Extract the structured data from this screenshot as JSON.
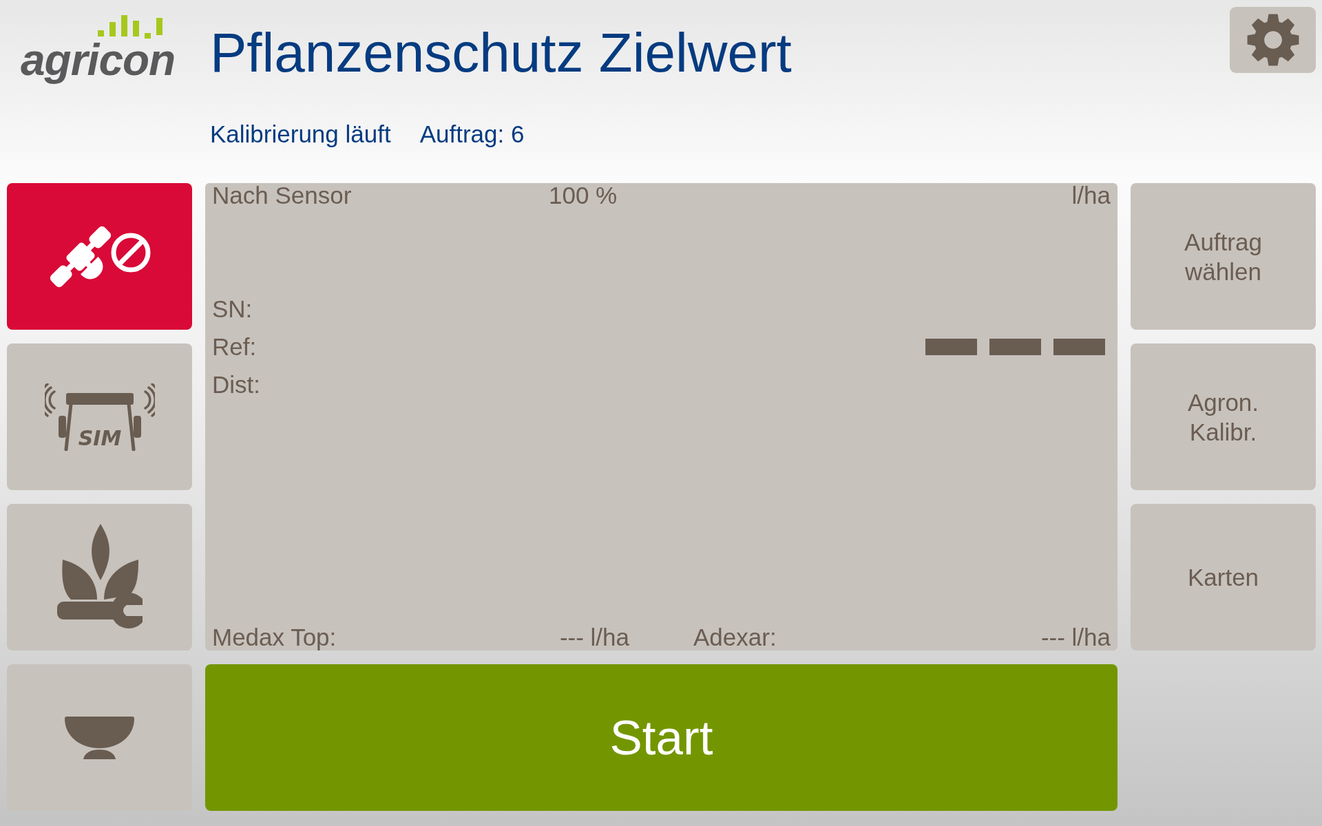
{
  "logo": {
    "text": "agricon"
  },
  "title": "Pflanzenschutz Zielwert",
  "status": [
    "Kalibrierung läuft",
    "Auftrag: 6"
  ],
  "side_buttons": [
    {
      "kind": "satellite",
      "alert": true
    },
    {
      "kind": "sprayer",
      "alert": false,
      "icon_text": "SIM"
    },
    {
      "kind": "plant-service",
      "alert": false
    },
    {
      "kind": "bowl",
      "alert": false
    }
  ],
  "panel": {
    "mode": "Nach Sensor",
    "percent": "100 %",
    "unit": "l/ha",
    "fields": [
      {
        "label": "SN:",
        "kind": "empty"
      },
      {
        "label": "Ref:",
        "kind": "dashes"
      },
      {
        "label": "Dist:",
        "kind": "empty"
      }
    ],
    "products": [
      {
        "name": "Medax Top:",
        "rate": "--- l/ha"
      },
      {
        "name": "Adexar:",
        "rate": "--- l/ha"
      }
    ]
  },
  "start_button": {
    "label": "Start"
  },
  "action_buttons": [
    {
      "label": "Auftrag wählen"
    },
    {
      "label": "Agron. Kalibr."
    },
    {
      "label": "Karten"
    }
  ]
}
